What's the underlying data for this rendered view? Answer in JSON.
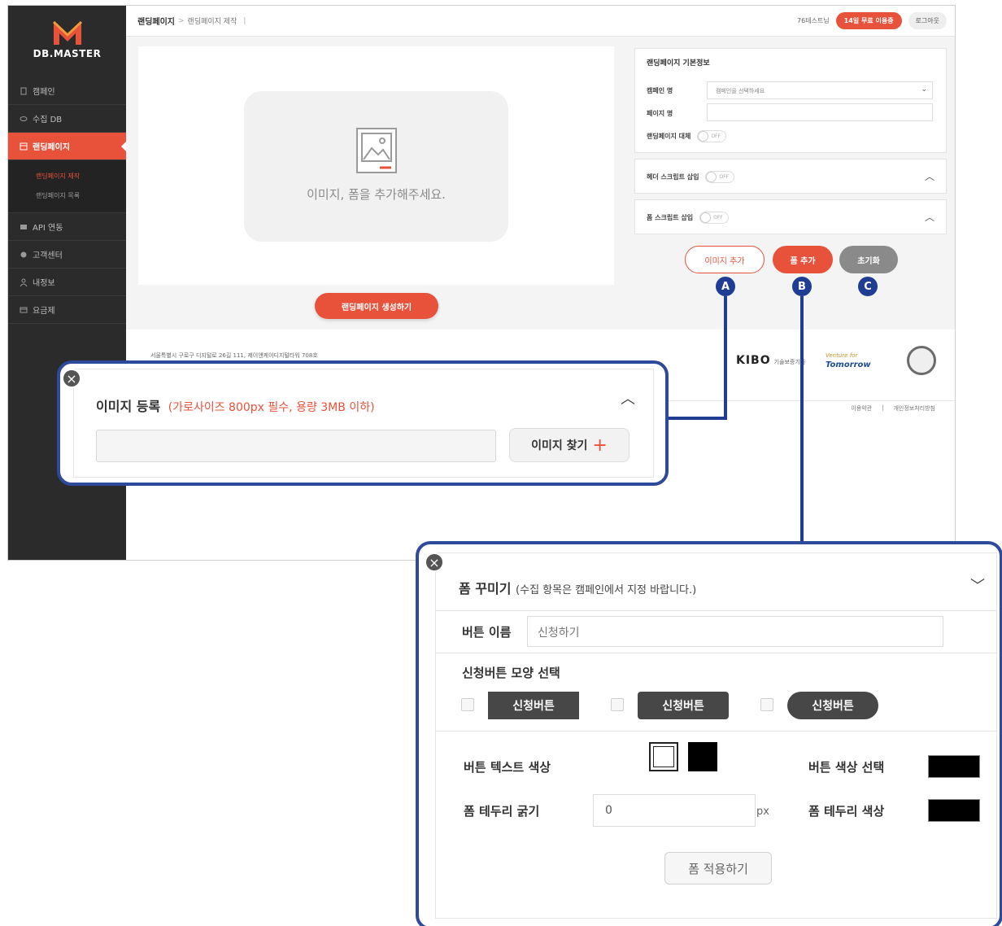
{
  "app": {
    "logo_text": "DB.MASTER",
    "accent_color": "#e8513a",
    "callout_color": "#2d4a9b"
  },
  "sidebar": {
    "items": [
      {
        "label": "캠페인",
        "icon": "document-icon"
      },
      {
        "label": "수집 DB",
        "icon": "database-icon"
      },
      {
        "label": "랜딩페이지",
        "icon": "landing-icon",
        "active": true
      },
      {
        "label": "API 연동",
        "icon": "api-icon"
      },
      {
        "label": "고객센터",
        "icon": "support-icon"
      },
      {
        "label": "내정보",
        "icon": "user-icon"
      },
      {
        "label": "요금제",
        "icon": "card-icon"
      }
    ],
    "sub_items": [
      "랜딩페이지 제작",
      "랜딩페이지 목록"
    ]
  },
  "header": {
    "breadcrumb_main": "랜딩페이지",
    "breadcrumb_sep": ">",
    "breadcrumb_sub": "랜딩페이지 제작",
    "breadcrumb_bar": "|",
    "user": "76테스트님",
    "trial_label": "14일 무료 이용중",
    "logout_label": "로그아웃"
  },
  "canvas": {
    "placeholder_text": "이미지, 폼을 추가해주세요.",
    "create_label": "랜딩페이지 생성하기"
  },
  "info_panel": {
    "title": "랜딩페이지 기본정보",
    "campaign_label": "캠페인 명",
    "campaign_placeholder": "캠페인을 선택하세요",
    "page_label": "페이지 명",
    "replace_label": "랜딩페이지 대체",
    "off_label": "OFF"
  },
  "header_script": {
    "label": "헤더 스크립트 삽입",
    "state": "OFF"
  },
  "form_script": {
    "label": "폼 스크립트 삽입",
    "state": "OFF"
  },
  "actions": {
    "add_image": "이미지 추가",
    "add_form": "폼 추가",
    "reset": "초기화"
  },
  "callouts": [
    "A",
    "B",
    "C"
  ],
  "footer": {
    "address": "서울특별시 구로구 디지털로 26길 111, 제이앤케이디지털타워 708호",
    "kibo": "KIBO",
    "kibo_sub": "기술보증기금",
    "venture_top": "Venture for",
    "venture_bottom": "Tomorrow",
    "terms": "이용약관",
    "privacy": "개인정보처리방침",
    "link_sep": "|"
  },
  "image_popup": {
    "title": "이미지 등록",
    "note": "(가로사이즈 800px 필수, 용량 3MB 이하)",
    "find_label": "이미지 찾기",
    "plus": "+"
  },
  "form_popup": {
    "title": "폼 꾸미기",
    "note": "(수집 항목은 캠페인에서 지정 바랍니다.)",
    "button_name_label": "버튼 이름",
    "button_name_value": "신청하기",
    "shape_title": "신청버튼 모양 선택",
    "shapes": [
      "신청버튼",
      "신청버튼",
      "신청버튼"
    ],
    "text_color_label": "버튼 텍스트 색상",
    "button_color_label": "버튼 색상 선택",
    "border_width_label": "폼 테두리 굵기",
    "border_width_value": "0",
    "border_unit": "px",
    "border_color_label": "폼 테두리 색상",
    "apply_label": "폼 적용하기",
    "swatch_colors": {
      "white": "#ffffff",
      "black": "#000000"
    }
  }
}
